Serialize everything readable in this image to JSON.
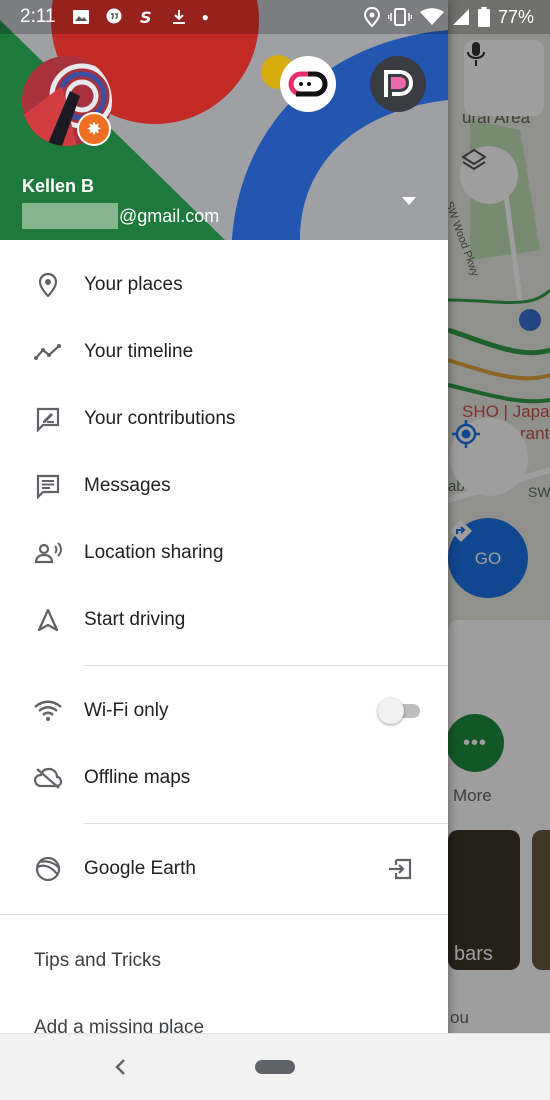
{
  "status_bar": {
    "time": "2:11",
    "battery": "77%"
  },
  "account": {
    "name": "Kellen B",
    "email_domain": "@gmail.com"
  },
  "menu_section1": [
    {
      "label": "Your places",
      "icon": "location-pin-icon"
    },
    {
      "label": "Your timeline",
      "icon": "timeline-icon"
    },
    {
      "label": "Your contributions",
      "icon": "contributions-icon"
    },
    {
      "label": "Messages",
      "icon": "message-icon"
    },
    {
      "label": "Location sharing",
      "icon": "location-sharing-icon"
    },
    {
      "label": "Start driving",
      "icon": "navigation-arrow-icon"
    }
  ],
  "menu_section2": [
    {
      "label": "Wi-Fi only",
      "icon": "wifi-icon",
      "toggle_on": false
    },
    {
      "label": "Offline maps",
      "icon": "offline-cloud-icon"
    }
  ],
  "menu_section3": [
    {
      "label": "Google Earth",
      "icon": "google-earth-icon",
      "trailing_icon": "open-external-icon"
    }
  ],
  "menu_text": [
    "Tips and Tricks",
    "Add a missing place"
  ],
  "map": {
    "label_rural_area": "ural Area",
    "label_street": "SW Wood Pkwy",
    "label_restaurant": "SHO | Japa",
    "label_restaurant2": "rant",
    "label_sw": "SW",
    "label_ab": "ab",
    "go_label": "GO",
    "more_label": "More",
    "bars_label": "bars",
    "you_label": "ou"
  },
  "colors": {
    "header_green": "#1e7a3c",
    "header_red": "#c22b25",
    "header_blue": "#2356b0",
    "go_blue": "#1a73e8",
    "more_green": "#1e8e3e",
    "text_primary": "#202124",
    "icon_grey": "#5f6368"
  }
}
